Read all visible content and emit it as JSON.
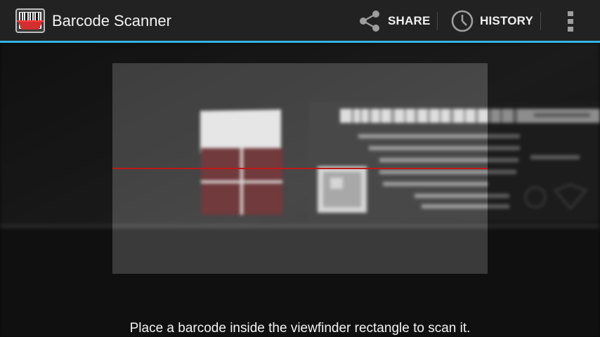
{
  "app": {
    "title": "Barcode Scanner",
    "icon": "barcode-app-icon"
  },
  "actions": {
    "share_label": "SHARE",
    "share_icon": "share-icon",
    "history_label": "HISTORY",
    "history_icon": "clock-icon",
    "overflow_icon": "overflow-menu-icon"
  },
  "viewfinder": {
    "status_text": "Place a barcode inside the viewfinder rectangle to scan it.",
    "laser_color": "#c01818"
  },
  "colors": {
    "accent": "#33b5e5",
    "actionbar_bg": "#222222"
  }
}
